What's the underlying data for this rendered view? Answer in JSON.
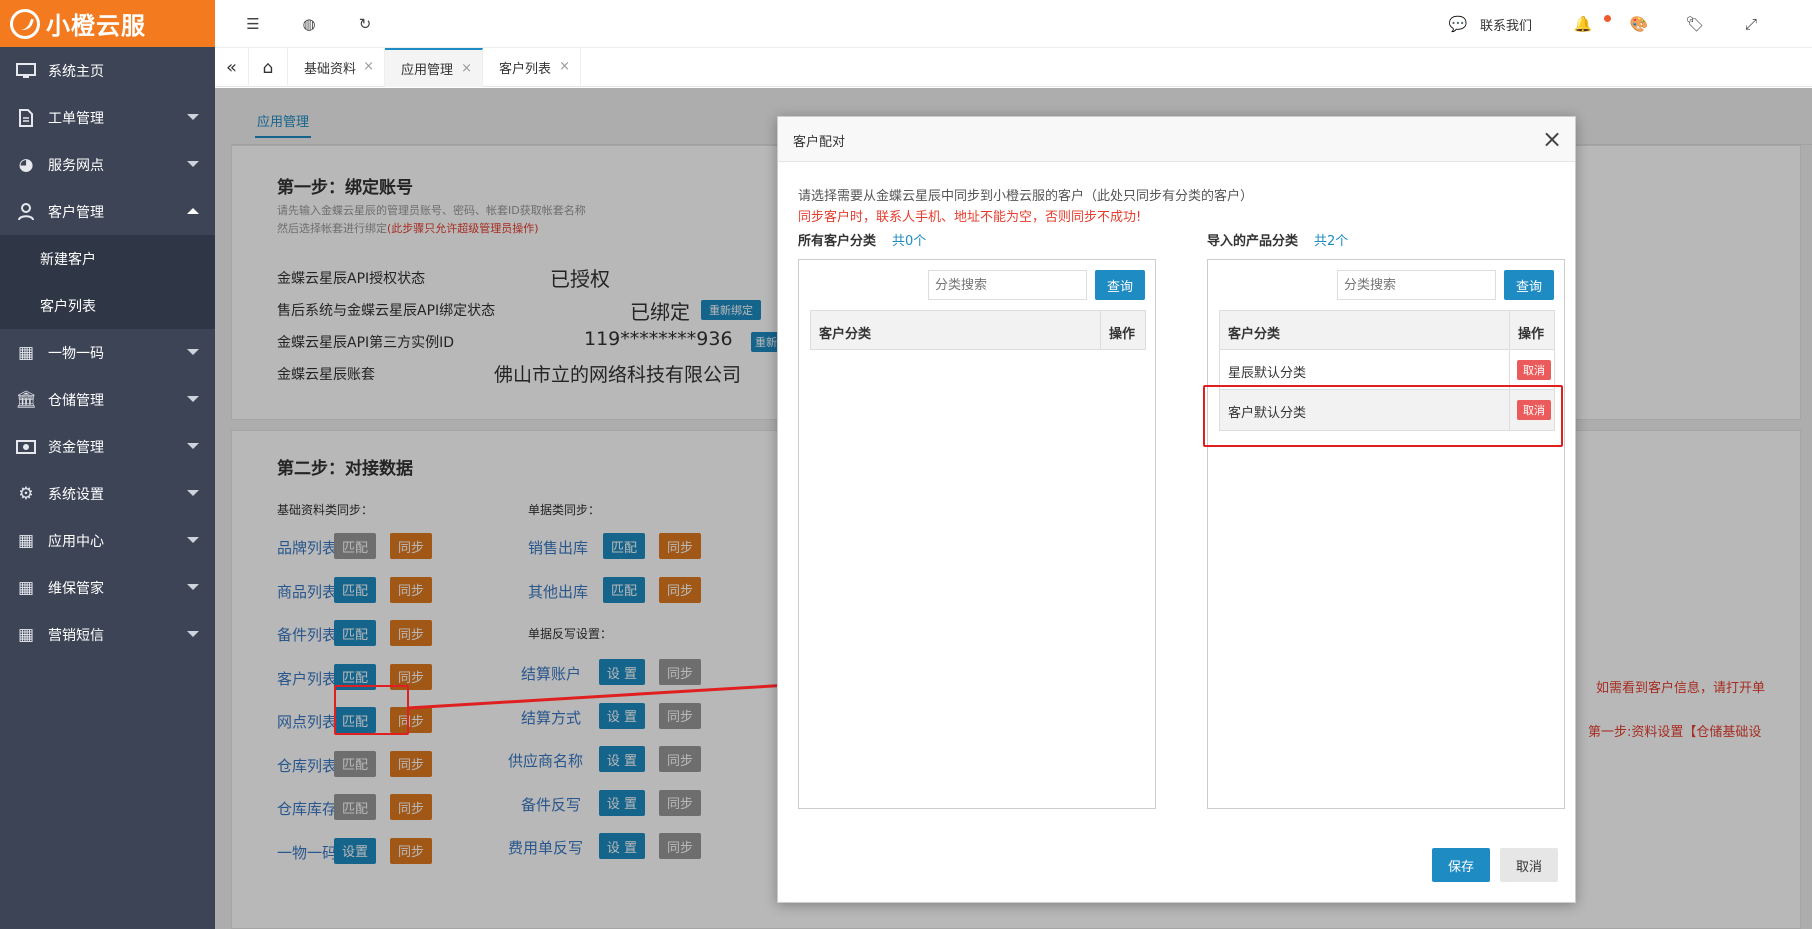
{
  "app": {
    "logo_text": "小橙云服"
  },
  "sidebar": {
    "items": [
      {
        "label": "系统主页",
        "icon": "monitor-icon"
      },
      {
        "label": "工单管理",
        "icon": "document-icon"
      },
      {
        "label": "服务网点",
        "icon": "globe-icon"
      },
      {
        "label": "客户管理",
        "icon": "user-icon"
      },
      {
        "label": "一物一码",
        "icon": "grid-icon"
      },
      {
        "label": "仓储管理",
        "icon": "bank-icon"
      },
      {
        "label": "资金管理",
        "icon": "money-icon"
      },
      {
        "label": "系统设置",
        "icon": "gear-icon"
      },
      {
        "label": "应用中心",
        "icon": "grid-icon"
      },
      {
        "label": "维保管家",
        "icon": "grid-icon"
      },
      {
        "label": "营销短信",
        "icon": "grid-icon"
      }
    ],
    "sub_items": [
      "新建客户",
      "客户列表"
    ]
  },
  "topbar": {
    "contact": "联系我们"
  },
  "tabs": [
    {
      "label": "基础资料"
    },
    {
      "label": "应用管理"
    },
    {
      "label": "客户列表"
    }
  ],
  "page": {
    "tab_title": "应用管理",
    "step1": {
      "title": "第一步：绑定账号",
      "desc1": "请先输入金蝶云星辰的管理员账号、密码、帐套ID获取帐套名称",
      "desc2": "然后选择帐套进行绑定",
      "desc2_red": "(此步骤只允许超级管理员操作)",
      "rows": [
        {
          "label": "金蝶云星辰API授权状态",
          "value": "已授权"
        },
        {
          "label": "售后系统与金蝶云星辰API绑定状态",
          "value": "已绑定",
          "btn": "重新绑定"
        },
        {
          "label": "金蝶云星辰API第三方实例ID",
          "value": "119********936",
          "btn": "重新获"
        },
        {
          "label": "金蝶云星辰账套",
          "value": "佛山市立的网络科技有限公司"
        }
      ]
    },
    "step2": {
      "title": "第二步：对接数据",
      "basic_title": "基础资料类同步：",
      "doc_title": "单据类同步：",
      "write_title": "单据反写设置：",
      "basic": [
        {
          "label": "品牌列表",
          "match": "匹配",
          "sync": "同步",
          "match_style": "gray"
        },
        {
          "label": "商品列表",
          "match": "匹配",
          "sync": "同步",
          "match_style": "blue"
        },
        {
          "label": "备件列表",
          "match": "匹配",
          "sync": "同步",
          "match_style": "blue"
        },
        {
          "label": "客户列表",
          "match": "匹配",
          "sync": "同步",
          "match_style": "blue"
        },
        {
          "label": "网点列表",
          "match": "匹配",
          "sync": "同步",
          "match_style": "blue"
        },
        {
          "label": "仓库列表",
          "match": "匹配",
          "sync": "同步",
          "match_style": "gray"
        },
        {
          "label": "仓库库存",
          "match": "匹配",
          "sync": "同步",
          "match_style": "gray"
        },
        {
          "label": "一物一码",
          "match": "设置",
          "sync": "同步",
          "match_style": "blue"
        }
      ],
      "docs": [
        {
          "label": "销售出库",
          "match": "匹配",
          "sync": "同步"
        },
        {
          "label": "其他出库",
          "match": "匹配",
          "sync": "同步"
        }
      ],
      "writes": [
        {
          "label": "结算账户",
          "set": "设 置",
          "sync": "同步"
        },
        {
          "label": "结算方式",
          "set": "设 置",
          "sync": "同步"
        },
        {
          "label": "供应商名称",
          "set": "设 置",
          "sync": "同步"
        },
        {
          "label": "备件反写",
          "set": "设 置",
          "sync": "同步"
        },
        {
          "label": "费用单反写",
          "set": "设 置",
          "sync": "同步"
        }
      ],
      "note1": "如需看到客户信息，请打开单",
      "note2": "第一步:资料设置【仓储基础设"
    }
  },
  "modal": {
    "title": "客户配对",
    "intro": "请选择需要从金蝶云星辰中同步到小橙云服的客户（此处只同步有分类的客户）",
    "warning": "同步客户时，联系人手机、地址不能为空，否则同步不成功!",
    "left": {
      "title": "所有客户分类",
      "count": "共0个",
      "search_placeholder": "分类搜索",
      "query": "查询",
      "col1": "客户分类",
      "col2": "操作"
    },
    "right": {
      "title": "导入的产品分类",
      "count": "共2个",
      "search_placeholder": "分类搜索",
      "query": "查询",
      "col1": "客户分类",
      "col2": "操作",
      "rows": [
        {
          "name": "星辰默认分类",
          "action": "取消"
        },
        {
          "name": "客户默认分类",
          "action": "取消"
        }
      ]
    },
    "save": "保存",
    "cancel": "取消"
  },
  "colors": {
    "brand": "#f37a1f",
    "sidebar": "#3c4456",
    "blue": "#1e8bc3",
    "orange": "#e07a1f",
    "annotation": "#e02020"
  }
}
